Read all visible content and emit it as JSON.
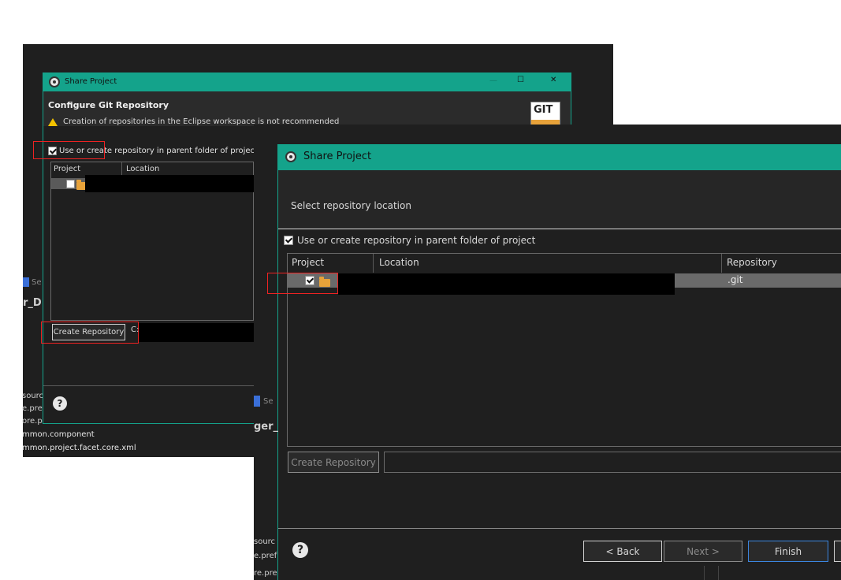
{
  "background_editor": {
    "files_top": [
      "sourc",
      "e.pref",
      "ore.pre",
      "mmon.component",
      "mmon.project.facet.core.xml"
    ],
    "fragment_se": "Se",
    "fragment_rd": "r_D",
    "fragment_ger": "ger_",
    "files_bottom": [
      "sourc",
      "e.pref",
      "re.pre"
    ]
  },
  "dialog_back": {
    "title": "Share Project",
    "heading": "Configure Git Repository",
    "warning": "Creation of repositories in the Eclipse workspace is not recommended",
    "git_logo": "GIT",
    "checkbox_label": "Use or create repository in parent folder of project",
    "checkbox_checked": true,
    "columns": [
      "Project",
      "Location"
    ],
    "create_repo_label": "Create Repository",
    "path_prefix": "C:",
    "minimize": "—",
    "maximize": "☐",
    "close": "✕"
  },
  "dialog_front": {
    "title": "Share Project",
    "subtitle": "Select repository location",
    "checkbox_label": "Use or create repository in parent folder of project",
    "checkbox_checked": true,
    "columns": [
      "Project",
      "Location",
      "Repository"
    ],
    "rows": [
      {
        "checked": true,
        "repository": ".git"
      }
    ],
    "create_repo_label": "Create Repository",
    "back_label": "< Back",
    "next_label": "Next >",
    "finish_label": "Finish",
    "help_glyph": "?"
  },
  "colors": {
    "title_bar": "#14a38b",
    "dialog_bg": "#1f1f1f",
    "highlight": "#e22222"
  }
}
